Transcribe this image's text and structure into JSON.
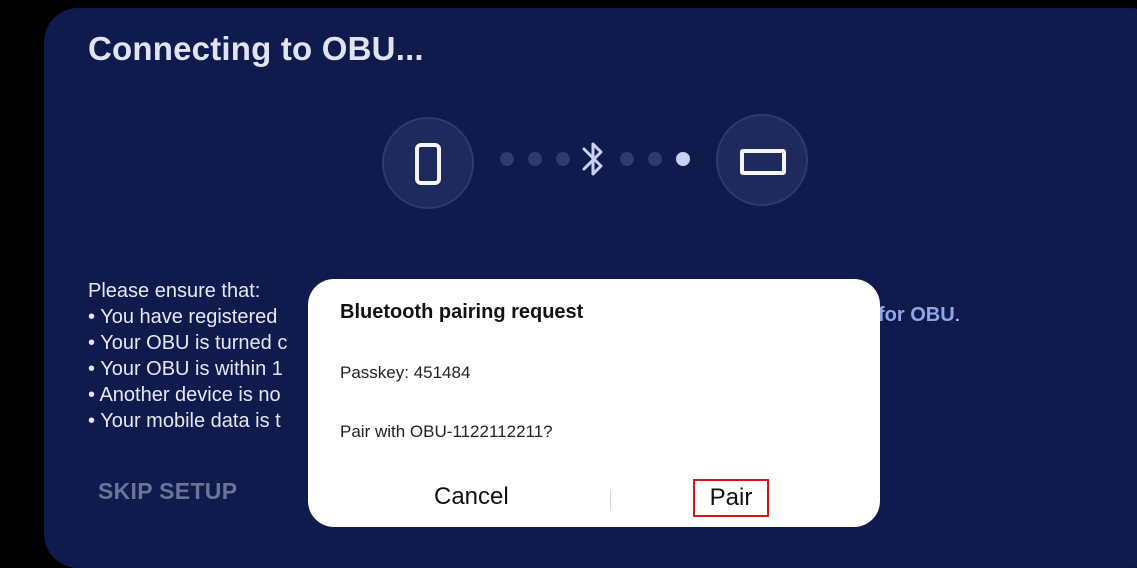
{
  "screen": {
    "title": "Connecting to OBU...",
    "diagram": {
      "left_device_icon": "phone-icon",
      "connection_icon": "bluetooth-icon",
      "right_device_icon": "obu-device-icon"
    },
    "instructions": {
      "intro": "Please ensure that:",
      "items": [
        "• You have registered",
        "• Your OBU is turned c",
        "• Your OBU is within 1",
        "• Another device is no",
        "• Your mobile data is t"
      ],
      "link_text": "for OBU",
      "link_suffix": "."
    },
    "skip_label": "SKIP SETUP"
  },
  "dialog": {
    "title": "Bluetooth pairing request",
    "passkey": "Passkey: 451484",
    "pair_with": "Pair with OBU-1122112211?",
    "cancel_label": "Cancel",
    "pair_label": "Pair"
  },
  "colors": {
    "background": "#0f1a4d",
    "link": "#8fa6e8",
    "highlight": "#d6161b"
  }
}
